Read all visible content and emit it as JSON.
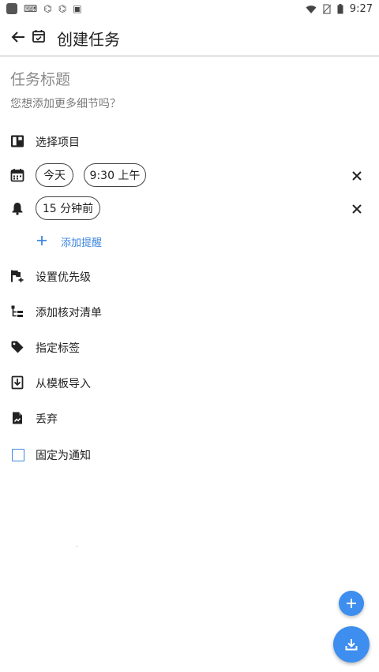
{
  "status_bar": {
    "time": "9:27",
    "left_icons": [
      "app-icon",
      "keyboard-icon",
      "debug-icon",
      "debug-icon",
      "a-icon"
    ],
    "right_icons": [
      "wifi-icon",
      "no-sim-icon",
      "battery-icon"
    ]
  },
  "appbar": {
    "title": "创建任务",
    "back_icon": "arrow-left-icon",
    "calendar_icon": "calendar-check-icon"
  },
  "task": {
    "title_placeholder": "任务标题",
    "description_placeholder": "您想添加更多细节吗？"
  },
  "project": {
    "label": "选择项目",
    "icon": "project-board-icon"
  },
  "due": {
    "date_chip": "今天",
    "time_chip": "9:30 上午",
    "icon": "calendar-icon"
  },
  "reminder": {
    "chip": "15 分钟前",
    "icon": "bell-icon",
    "add_label": "添加提醒"
  },
  "options": [
    {
      "label": "设置优先级",
      "icon": "priority-flag-icon"
    },
    {
      "label": "添加核对清单",
      "icon": "checklist-icon"
    },
    {
      "label": "指定标签",
      "icon": "tag-icon"
    },
    {
      "label": "从模板导入",
      "icon": "template-import-icon"
    },
    {
      "label": "丢弃",
      "icon": "discard-file-icon"
    },
    {
      "label": "固定为通知",
      "icon": "checkbox-icon"
    }
  ],
  "colors": {
    "accent": "#3d86e0",
    "fab": "#3d8eee",
    "text": "#222222",
    "hint": "#8a8a8a"
  },
  "fabs": {
    "small_icon": "plus-icon",
    "big_icon": "download-icon"
  }
}
